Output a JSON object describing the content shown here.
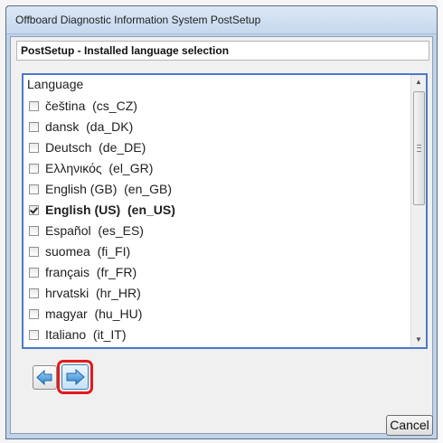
{
  "window": {
    "title": "Offboard Diagnostic Information System PostSetup"
  },
  "header": {
    "title": "PostSetup - Installed language selection"
  },
  "language_list": {
    "column_header": "Language",
    "items": [
      {
        "label": "čeština  (cs_CZ)",
        "checked": false
      },
      {
        "label": "dansk  (da_DK)",
        "checked": false
      },
      {
        "label": "Deutsch  (de_DE)",
        "checked": false
      },
      {
        "label": "Ελληνικός  (el_GR)",
        "checked": false
      },
      {
        "label": "English (GB)  (en_GB)",
        "checked": false
      },
      {
        "label": "English (US)  (en_US)",
        "checked": true
      },
      {
        "label": "Español  (es_ES)",
        "checked": false
      },
      {
        "label": "suomea  (fi_FI)",
        "checked": false
      },
      {
        "label": "français  (fr_FR)",
        "checked": false
      },
      {
        "label": "hrvatski  (hr_HR)",
        "checked": false
      },
      {
        "label": "magyar  (hu_HU)",
        "checked": false
      },
      {
        "label": "Italiano  (it_IT)",
        "checked": false
      }
    ]
  },
  "navigation": {
    "back_icon": "arrow-left-icon",
    "next_icon": "arrow-right-icon",
    "highlight_color": "#e21b1b"
  },
  "footer": {
    "cancel_label": "Cancel"
  }
}
